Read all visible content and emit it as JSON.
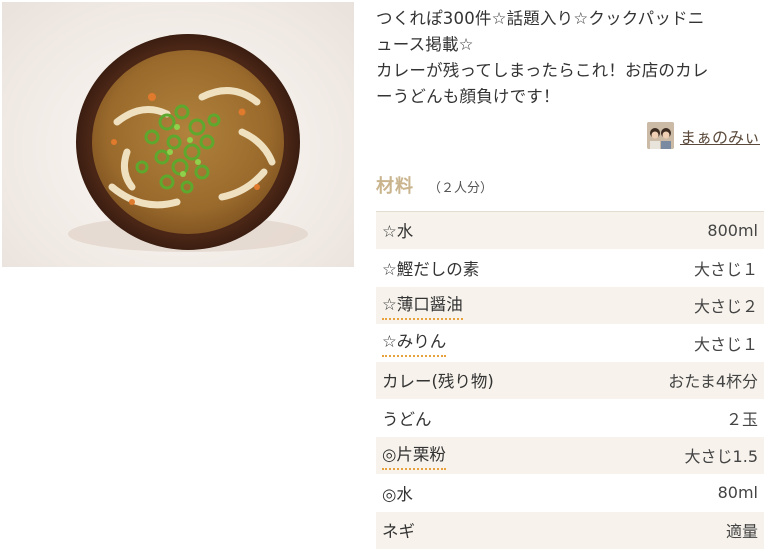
{
  "recipe": {
    "image_alt": "カレーうどん",
    "description_lines": [
      "つくれぽ300件☆話題入り☆クックパッドニ",
      "ュース掲載☆",
      "カレーが残ってしまったらこれ！お店のカレ",
      "ーうどんも顔負けです！"
    ],
    "author": {
      "name": "まぁのみぃ",
      "icon": "avatar-photo"
    }
  },
  "ingredients": {
    "title": "材料",
    "servings": "（２人分）",
    "items": [
      {
        "name": "☆水",
        "amount": "800ml",
        "link": false
      },
      {
        "name": "☆鰹だしの素",
        "amount": "大さじ１",
        "link": false
      },
      {
        "name": "☆薄口醤油",
        "amount": "大さじ２",
        "link": true
      },
      {
        "name": "☆みりん",
        "amount": "大さじ１",
        "link": true
      },
      {
        "name": "カレー(残り物)",
        "amount": "おたま4杯分",
        "link": false
      },
      {
        "name": "うどん",
        "amount": "２玉",
        "link": false
      },
      {
        "name": "◎片栗粉",
        "amount": "大さじ1.5",
        "link": true
      },
      {
        "name": "◎水",
        "amount": "80ml",
        "link": false
      },
      {
        "name": "ネギ",
        "amount": "適量",
        "link": false
      }
    ]
  },
  "colors": {
    "title": "#c9b48e",
    "row_alt": "#f7f3ec",
    "link_underline": "#e9a13b"
  }
}
